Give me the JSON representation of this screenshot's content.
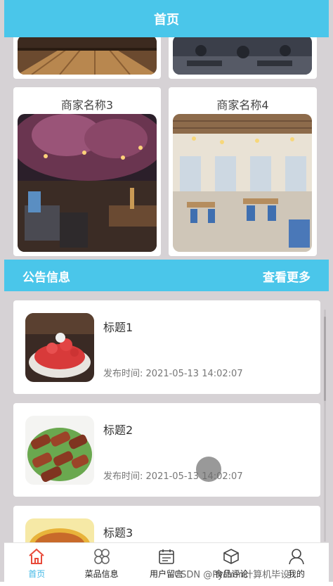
{
  "header": {
    "title": "首页"
  },
  "merchants": [
    {
      "name": "商家名称3"
    },
    {
      "name": "商家名称4"
    }
  ],
  "notices_section": {
    "title": "公告信息",
    "more": "查看更多"
  },
  "notices": [
    {
      "title": "标题1",
      "time_label": "发布时间:",
      "time": "2021-05-13 14:02:07"
    },
    {
      "title": "标题2",
      "time_label": "发布时间:",
      "time": "2021-05-13 14:02:07"
    },
    {
      "title": "标题3"
    }
  ],
  "tabbar": {
    "items": [
      {
        "label": "首页",
        "icon": "home-icon"
      },
      {
        "label": "菜品信息",
        "icon": "grid-icon"
      },
      {
        "label": "用户留言",
        "icon": "calendar-icon"
      },
      {
        "label": "食品评论",
        "icon": "box-icon"
      },
      {
        "label": "我的",
        "icon": "user-icon"
      }
    ]
  },
  "watermark": "CSDN @Python计算机毕设",
  "colors": {
    "accent": "#4ac6ea",
    "active_tab": "#43b8e6"
  }
}
